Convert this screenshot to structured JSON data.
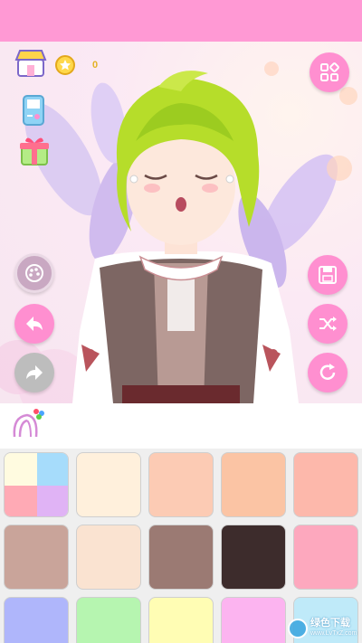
{
  "hud": {
    "coin_count": "0"
  },
  "palette": {
    "accent": "#ff99d4",
    "button": "#ff8fd0",
    "disabled_button": "#bdbdbd"
  },
  "swatches": [
    {
      "type": "multi",
      "colors": [
        "#fffbe0",
        "#a6dcfb",
        "#ffaab5",
        "#e0b3f5"
      ]
    },
    {
      "type": "solid",
      "color": "#fff0dc"
    },
    {
      "type": "solid",
      "color": "#fccbb4"
    },
    {
      "type": "solid",
      "color": "#fbc4a4"
    },
    {
      "type": "solid",
      "color": "#fdb8ab"
    },
    {
      "type": "solid",
      "color": "#c9a49a"
    },
    {
      "type": "solid",
      "color": "#fae3d1"
    },
    {
      "type": "solid",
      "color": "#9b7a73"
    },
    {
      "type": "solid",
      "color": "#3d2c2c"
    },
    {
      "type": "solid",
      "color": "#fda8be"
    },
    {
      "type": "solid",
      "color": "#afb6fb"
    },
    {
      "type": "solid",
      "color": "#b6f5b0"
    },
    {
      "type": "solid",
      "color": "#fffdb4"
    },
    {
      "type": "solid",
      "color": "#fcb4f0"
    },
    {
      "type": "solid",
      "color": "#bfeaf9"
    }
  ],
  "watermark": {
    "title": "绿色下载",
    "subtitle": "www.LvTxZ.com"
  }
}
